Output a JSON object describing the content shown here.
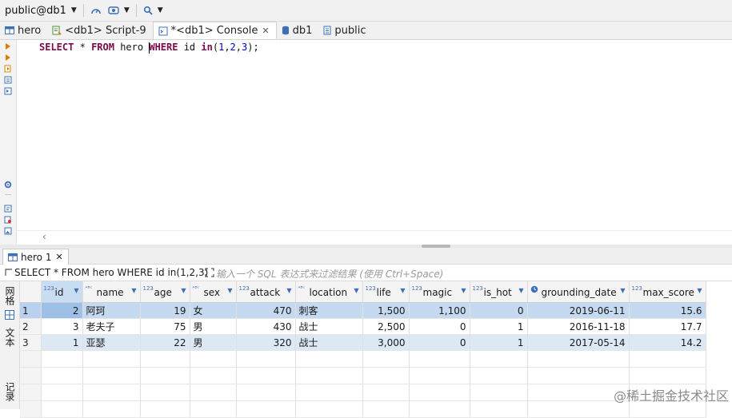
{
  "toolbar": {
    "connection": "public@db1"
  },
  "tabs": [
    {
      "label": "hero",
      "icon": "table-icon"
    },
    {
      "label": "<db1> Script-9",
      "icon": "script-icon"
    },
    {
      "label": "*<db1> Console",
      "icon": "console-icon",
      "active": true
    },
    {
      "label": "db1",
      "icon": "database-icon"
    },
    {
      "label": "public",
      "icon": "schema-icon"
    }
  ],
  "editor": {
    "sql": "SELECT * FROM hero WHERE id in(1,2,3);"
  },
  "result": {
    "tab_label": "hero 1",
    "query": "SELECT * FROM hero WHERE id in(1,2,3)",
    "filter_placeholder": "输入一个 SQL 表达式来过滤结果 (使用 Ctrl+Space)",
    "side_panel": [
      "网格",
      "文本",
      "记录"
    ],
    "columns": [
      {
        "name": "id",
        "type": "123"
      },
      {
        "name": "name",
        "type": "ABC"
      },
      {
        "name": "age",
        "type": "123"
      },
      {
        "name": "sex",
        "type": "ABC"
      },
      {
        "name": "attack",
        "type": "123"
      },
      {
        "name": "location",
        "type": "ABC"
      },
      {
        "name": "life",
        "type": "123"
      },
      {
        "name": "magic",
        "type": "123"
      },
      {
        "name": "is_hot",
        "type": "123"
      },
      {
        "name": "grounding_date",
        "type": "date"
      },
      {
        "name": "max_score",
        "type": "123"
      }
    ],
    "rows": [
      [
        "1",
        "2",
        "阿珂",
        "19",
        "女",
        "470",
        "刺客",
        "1,500",
        "1,100",
        "0",
        "2019-06-11",
        "15.6"
      ],
      [
        "2",
        "3",
        "老夫子",
        "75",
        "男",
        "430",
        "战士",
        "2,500",
        "0",
        "1",
        "2016-11-18",
        "17.7"
      ],
      [
        "3",
        "1",
        "亚瑟",
        "22",
        "男",
        "320",
        "战士",
        "3,000",
        "0",
        "1",
        "2017-05-14",
        "14.2"
      ]
    ]
  },
  "watermark": "@稀土掘金技术社区"
}
